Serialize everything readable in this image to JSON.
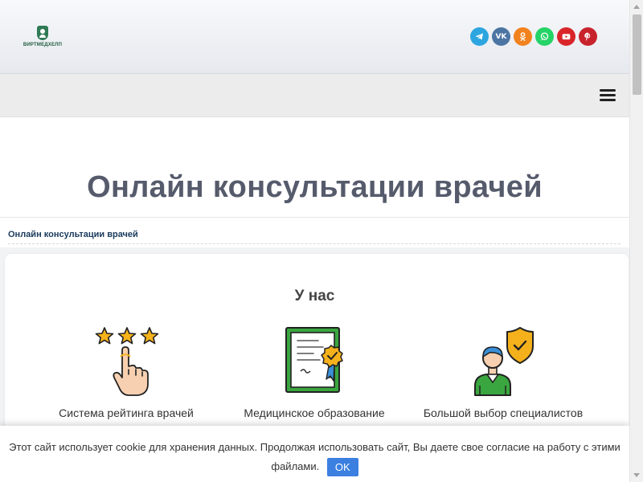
{
  "header": {
    "logo_text": "ВИРТМЕДХЕЛП",
    "socials": [
      {
        "name": "telegram-icon",
        "color": "#2ca5e0"
      },
      {
        "name": "vk-icon",
        "color": "#4c75a3",
        "glyph": "VK"
      },
      {
        "name": "odnoklassniki-icon",
        "color": "#f2821e"
      },
      {
        "name": "whatsapp-icon",
        "color": "#25d366"
      },
      {
        "name": "youtube-icon",
        "color": "#d9252a"
      },
      {
        "name": "pinterest-icon",
        "color": "#c8232c"
      }
    ]
  },
  "nav": {
    "menu_icon": "hamburger-icon"
  },
  "page": {
    "title": "Онлайн консультации врачей",
    "breadcrumb": "Онлайн консультации врачей"
  },
  "section": {
    "title": "У нас",
    "features": [
      {
        "label": "Система рейтинга врачей",
        "icon": "star-rating-hand-icon"
      },
      {
        "label": "Медицинское образование",
        "icon": "certificate-diploma-icon"
      },
      {
        "label": "Большой выбор специалистов",
        "icon": "doctor-shield-icon"
      }
    ]
  },
  "cookie": {
    "text": "Этот сайт использует cookie для хранения данных. Продолжая использовать сайт, Вы даете свое согласие на работу с этими файлами.",
    "ok_label": "OK"
  },
  "colors": {
    "accent": "#3b7fe0",
    "title": "#565b6c",
    "breadcrumb": "#1a3a5c"
  }
}
